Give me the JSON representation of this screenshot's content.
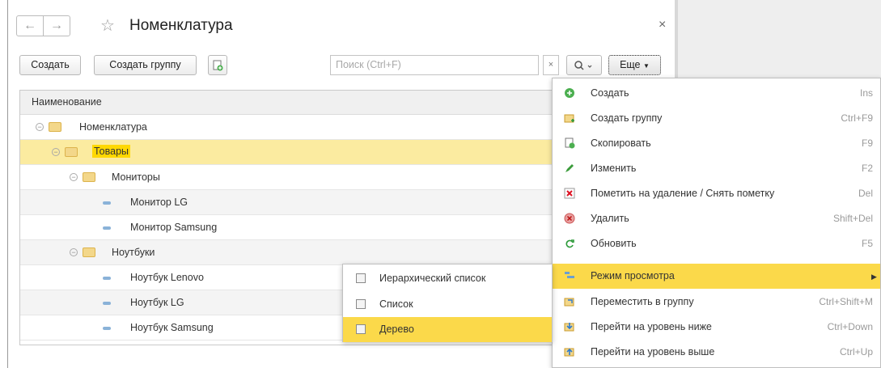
{
  "window": {
    "title": "Номенклатура",
    "close_glyph": "×",
    "back_glyph": "←",
    "forward_glyph": "→",
    "star_glyph": "☆"
  },
  "toolbar": {
    "create_label": "Создать",
    "create_group_label": "Создать группу",
    "search_placeholder": "Поиск (Ctrl+F)",
    "search_clear_glyph": "×",
    "more_label": "Еще"
  },
  "table": {
    "header": "Наименование",
    "rows": [
      {
        "label": "Номенклатура",
        "type": "folder"
      },
      {
        "label": "Товары",
        "type": "folder"
      },
      {
        "label": "Мониторы",
        "type": "folder"
      },
      {
        "label": "Монитор LG",
        "type": "item"
      },
      {
        "label": "Монитор Samsung",
        "type": "item"
      },
      {
        "label": "Ноутбуки",
        "type": "folder"
      },
      {
        "label": "Ноутбук Lenovo",
        "type": "item"
      },
      {
        "label": "Ноутбук LG",
        "type": "item"
      },
      {
        "label": "Ноутбук Samsung",
        "type": "item"
      }
    ]
  },
  "menu": {
    "items": [
      {
        "label": "Создать",
        "shortcut": "Ins",
        "icon": "plus-circle-icon"
      },
      {
        "label": "Создать группу",
        "shortcut": "Ctrl+F9",
        "icon": "folder-add-icon"
      },
      {
        "label": "Скопировать",
        "shortcut": "F9",
        "icon": "copy-icon"
      },
      {
        "label": "Изменить",
        "shortcut": "F2",
        "icon": "pencil-icon"
      },
      {
        "label": "Пометить на удаление / Снять пометку",
        "shortcut": "Del",
        "icon": "mark-delete-icon"
      },
      {
        "label": "Удалить",
        "shortcut": "Shift+Del",
        "icon": "delete-icon"
      },
      {
        "label": "Обновить",
        "shortcut": "F5",
        "icon": "refresh-icon"
      },
      {
        "label": "Режим просмотра",
        "shortcut": "",
        "icon": "view-mode-icon"
      },
      {
        "label": "Переместить в группу",
        "shortcut": "Ctrl+Shift+M",
        "icon": "move-to-group-icon"
      },
      {
        "label": "Перейти на уровень ниже",
        "shortcut": "Ctrl+Down",
        "icon": "level-down-icon"
      },
      {
        "label": "Перейти на уровень выше",
        "shortcut": "Ctrl+Up",
        "icon": "level-up-icon"
      }
    ],
    "submenu_arrow": "▶"
  },
  "submenu": {
    "items": [
      {
        "label": "Иерархический список"
      },
      {
        "label": "Список"
      },
      {
        "label": "Дерево"
      }
    ]
  },
  "colors": {
    "selection": "#fbd94a",
    "row_selected": "#fbeba0",
    "highlight": "#ffd800"
  }
}
